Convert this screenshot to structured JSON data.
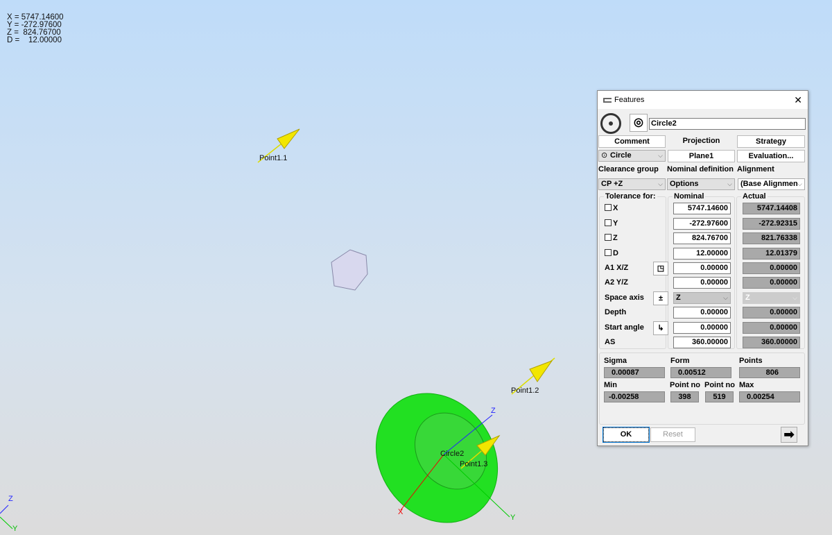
{
  "readout": {
    "x": "X = 5747.14600",
    "y": "Y = -272.97600",
    "z": "Z =  824.76700",
    "d": "D =    12.00000"
  },
  "scene": {
    "point11": "Point1.1",
    "point12": "Point1.2",
    "point13": "Point1.3",
    "circle2": "Circle2",
    "axis_x": "X",
    "axis_y": "Y",
    "axis_z": "Z"
  },
  "dialog": {
    "title": "Features",
    "close": "✕",
    "name": "Circle2",
    "comment": "Comment",
    "projection": "Projection",
    "strategy": "Strategy",
    "type": "Circle",
    "plane": "Plane1",
    "evaluation": "Evaluation...",
    "clearance_label": "Clearance group",
    "nominal_def_label": "Nominal definition",
    "alignment_label": "Alignment",
    "clearance": "CP +Z",
    "nominal_def": "Options",
    "alignment": "(Base Alignment",
    "tol_header": "Tolerance for:",
    "nominal_header": "Nominal",
    "actual_header": "Actual",
    "rows": [
      {
        "label": "X",
        "nominal": "5747.14600",
        "actual": "5747.14408"
      },
      {
        "label": "Y",
        "nominal": "-272.97600",
        "actual": "-272.92315"
      },
      {
        "label": "Z",
        "nominal": "824.76700",
        "actual": "821.76338"
      },
      {
        "label": "D",
        "nominal": "12.00000",
        "actual": "12.01379"
      },
      {
        "label": "A1 X/Z",
        "nominal": "0.00000",
        "actual": "0.00000"
      },
      {
        "label": "A2 Y/Z",
        "nominal": "0.00000",
        "actual": "0.00000"
      },
      {
        "label": "Space axis",
        "nominal": "Z",
        "actual": "Z"
      },
      {
        "label": "Depth",
        "nominal": "0.00000",
        "actual": "0.00000"
      },
      {
        "label": "Start angle",
        "nominal": "0.00000",
        "actual": "0.00000"
      },
      {
        "label": "AS",
        "nominal": "360.00000",
        "actual": "360.00000"
      }
    ],
    "space_axis_btn": "±",
    "sigma_label": "Sigma",
    "sigma": "0.00087",
    "form_label": "Form",
    "form": "0.00512",
    "points_label": "Points",
    "points": "806",
    "min_label": "Min",
    "min": "-0.00258",
    "pointno_label": "Point no",
    "pointno_min": "398",
    "pointno_max": "519",
    "max_label": "Max",
    "max": "0.00254",
    "ok": "OK",
    "reset": "Reset"
  }
}
